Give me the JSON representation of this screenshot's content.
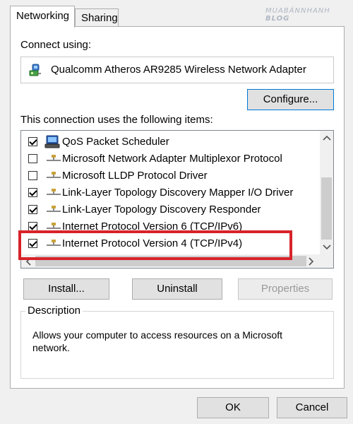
{
  "tabs": [
    {
      "label": "Networking",
      "active": true
    },
    {
      "label": "Sharing",
      "active": false
    }
  ],
  "connect_using_label": "Connect using:",
  "adapter_name": "Qualcomm Atheros AR9285 Wireless Network Adapter",
  "configure_button": "Configure...",
  "items_label": "This connection uses the following items:",
  "items": [
    {
      "label": "QoS Packet Scheduler",
      "checked": true,
      "icon": "scheduler-icon"
    },
    {
      "label": "Microsoft Network Adapter Multiplexor Protocol",
      "checked": false,
      "icon": "network-protocol-icon"
    },
    {
      "label": "Microsoft LLDP Protocol Driver",
      "checked": false,
      "icon": "network-protocol-icon"
    },
    {
      "label": "Link-Layer Topology Discovery Mapper I/O Driver",
      "checked": true,
      "icon": "network-protocol-icon"
    },
    {
      "label": "Link-Layer Topology Discovery Responder",
      "checked": true,
      "icon": "network-protocol-icon"
    },
    {
      "label": "Internet Protocol Version 6 (TCP/IPv6)",
      "checked": true,
      "icon": "network-protocol-icon"
    },
    {
      "label": "Internet Protocol Version 4 (TCP/IPv4)",
      "checked": true,
      "icon": "network-protocol-icon",
      "highlighted": true
    }
  ],
  "buttons": {
    "install": "Install...",
    "uninstall": "Uninstall",
    "properties": "Properties",
    "ok": "OK",
    "cancel": "Cancel"
  },
  "description": {
    "title": "Description",
    "text": "Allows your computer to access resources on a Microsoft network."
  },
  "watermark": {
    "line1": "MUABÁNNHANH",
    "line2": "BLOG"
  },
  "colors": {
    "highlight": "#d8232a",
    "focus": "#0078d7"
  }
}
